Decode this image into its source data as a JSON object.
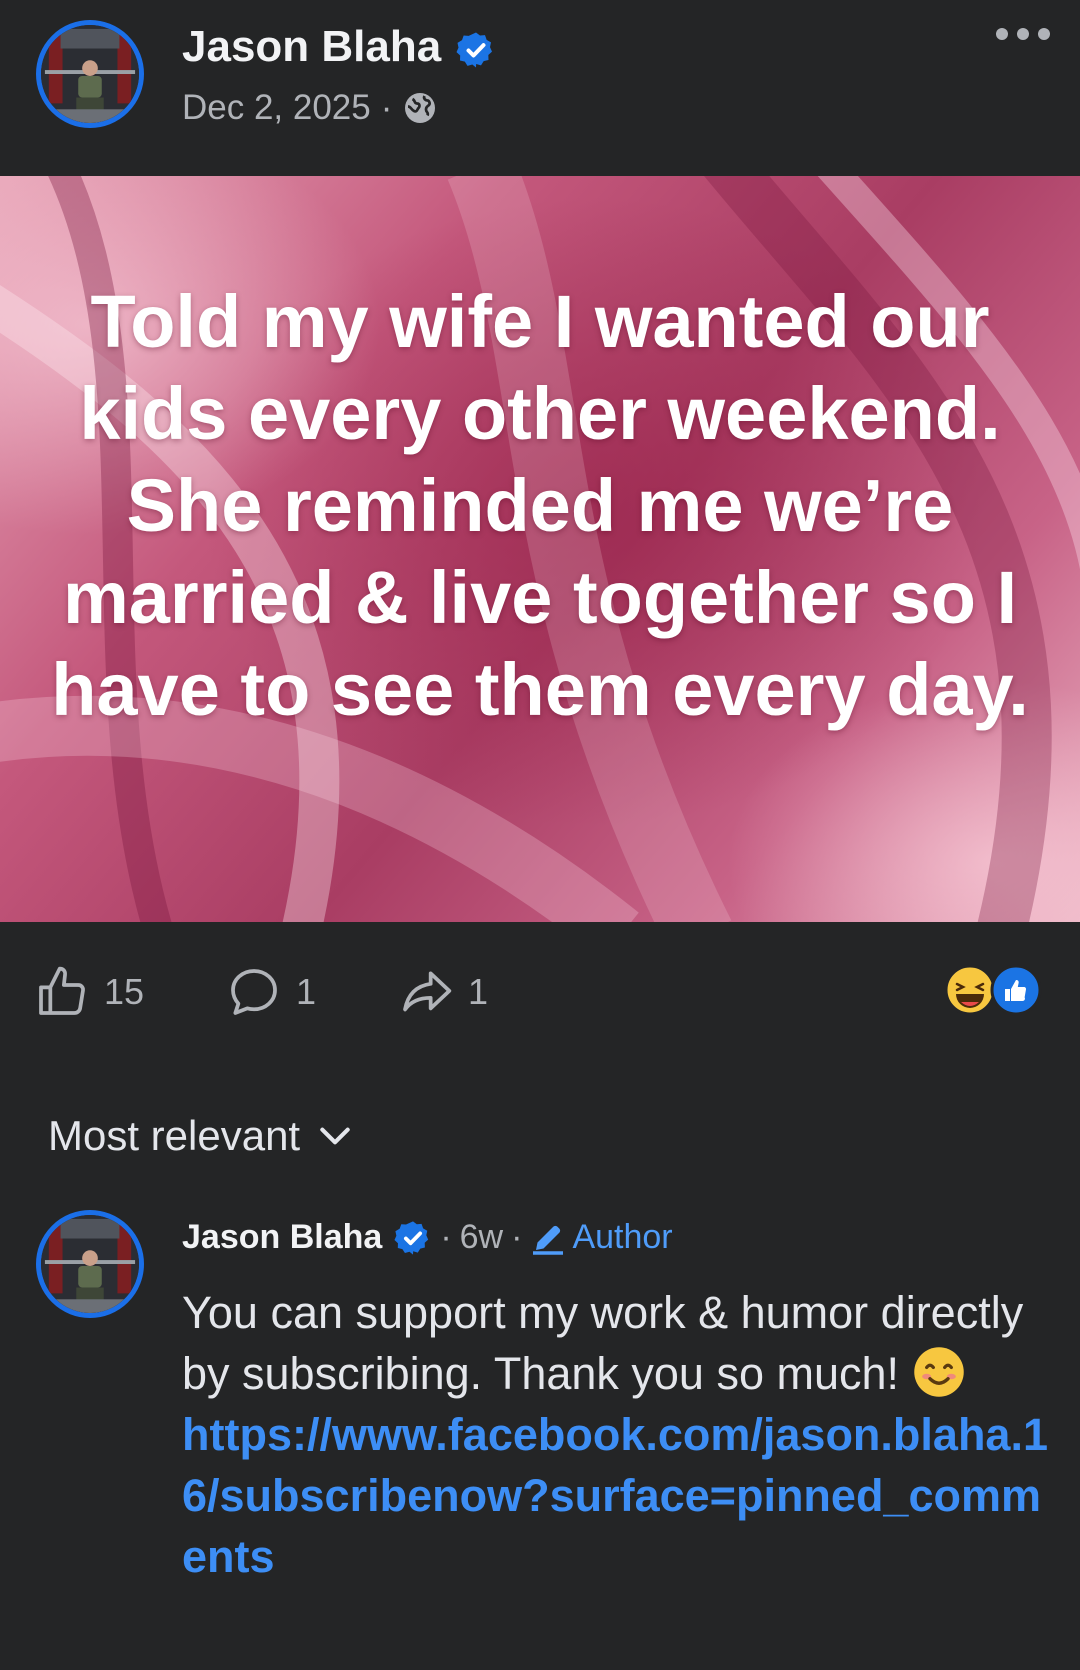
{
  "post": {
    "author": "Jason Blaha",
    "date": "Dec 2, 2025",
    "separator": "·",
    "privacy_icon": "globe-icon",
    "image_text": "Told my wife I wanted our kids every other weekend. She reminded me we’re married & live together so I have to see them every day."
  },
  "actions": {
    "likes": "15",
    "comments": "1",
    "shares": "1",
    "reaction_icons": [
      "haha-icon",
      "like-icon"
    ]
  },
  "comments_sort": {
    "label": "Most relevant"
  },
  "comment": {
    "author": "Jason Blaha",
    "time": "6w",
    "separator": "·",
    "badge": "Author",
    "text": "You can support my work & humor directly by subscribing. Thank you so much!",
    "link": "https://www.facebook.com/jason.blaha.16/subscribenow?surface=pinned_comments"
  },
  "colors": {
    "background": "#242526",
    "accent": "#1b6fe8",
    "link": "#3d8ef5",
    "muted": "#b0b3b8"
  }
}
